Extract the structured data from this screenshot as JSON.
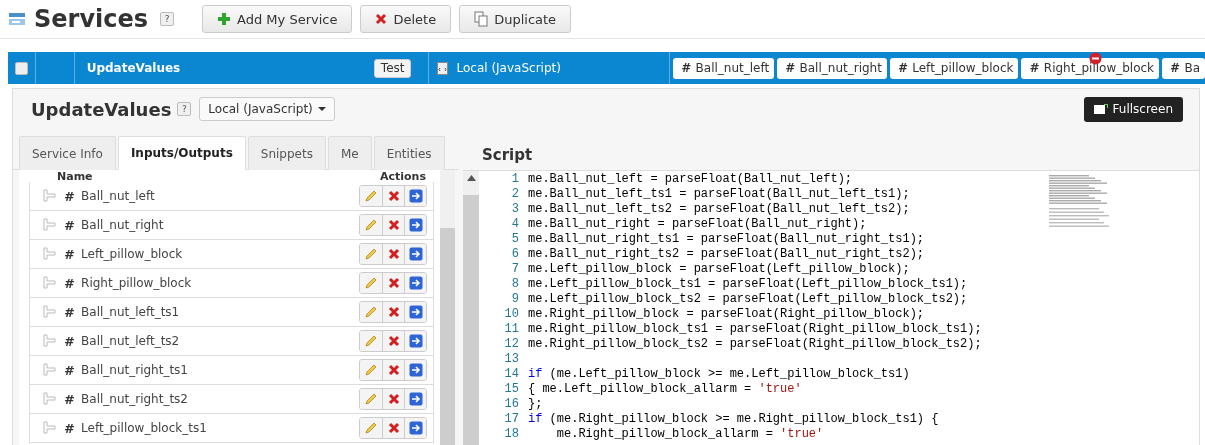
{
  "page": {
    "title": "Services",
    "help": "?"
  },
  "toolbar": [
    {
      "label": "Add My Service",
      "kind": "add"
    },
    {
      "label": "Delete",
      "kind": "delete"
    },
    {
      "label": "Duplicate",
      "kind": "duplicate"
    }
  ],
  "service_row": {
    "checked": false,
    "name": "UpdateValues",
    "test_button": "Test",
    "handler": "Local (JavaScript)",
    "parameters": [
      {
        "symbol": "#",
        "name": "Ball_nut_left",
        "show_remove": false
      },
      {
        "symbol": "#",
        "name": "Ball_nut_right",
        "show_remove": false
      },
      {
        "symbol": "#",
        "name": "Left_pillow_block",
        "show_remove": false
      },
      {
        "symbol": "#",
        "name": "Right_pillow_block",
        "show_remove": true
      },
      {
        "symbol": "#",
        "name": "Ba",
        "show_remove": false
      }
    ]
  },
  "editor": {
    "title": "UpdateValues",
    "help": "?",
    "handler_dropdown": "Local (JavaScript)",
    "fullscreen_button": "Fullscreen",
    "tabs": [
      {
        "label": "Service Info",
        "selected": false
      },
      {
        "label": "Inputs/Outputs",
        "selected": true
      },
      {
        "label": "Snippets",
        "selected": false
      },
      {
        "label": "Me",
        "selected": false
      },
      {
        "label": "Entities",
        "selected": false
      }
    ],
    "script_title": "Script",
    "columns": {
      "name": "Name",
      "actions": "Actions"
    },
    "inputs": [
      {
        "symbol": "#",
        "name": "Ball_nut_left"
      },
      {
        "symbol": "#",
        "name": "Ball_nut_right"
      },
      {
        "symbol": "#",
        "name": "Left_pillow_block"
      },
      {
        "symbol": "#",
        "name": "Right_pillow_block"
      },
      {
        "symbol": "#",
        "name": "Ball_nut_left_ts1"
      },
      {
        "symbol": "#",
        "name": "Ball_nut_left_ts2"
      },
      {
        "symbol": "#",
        "name": "Ball_nut_right_ts1"
      },
      {
        "symbol": "#",
        "name": "Ball_nut_right_ts2"
      },
      {
        "symbol": "#",
        "name": "Left_pillow_block_ts1"
      }
    ],
    "code": [
      {
        "number": "1",
        "tokens": [
          {
            "kind": "plain",
            "text": "me.Ball_nut_left = parseFloat(Ball_nut_left);"
          }
        ]
      },
      {
        "number": "2",
        "tokens": [
          {
            "kind": "plain",
            "text": "me.Ball_nut_left_ts1 = parseFloat(Ball_nut_left_ts1);"
          }
        ]
      },
      {
        "number": "3",
        "tokens": [
          {
            "kind": "plain",
            "text": "me.Ball_nut_left_ts2 = parseFloat(Ball_nut_left_ts2);"
          }
        ]
      },
      {
        "number": "4",
        "tokens": [
          {
            "kind": "plain",
            "text": "me.Ball_nut_right = parseFloat(Ball_nut_right);"
          }
        ]
      },
      {
        "number": "5",
        "tokens": [
          {
            "kind": "plain",
            "text": "me.Ball_nut_right_ts1 = parseFloat(Ball_nut_right_ts1);"
          }
        ]
      },
      {
        "number": "6",
        "tokens": [
          {
            "kind": "plain",
            "text": "me.Ball_nut_right_ts2 = parseFloat(Ball_nut_right_ts2);"
          }
        ]
      },
      {
        "number": "7",
        "tokens": [
          {
            "kind": "plain",
            "text": "me.Left_pillow_block = parseFloat(Left_pillow_block);"
          }
        ]
      },
      {
        "number": "8",
        "tokens": [
          {
            "kind": "plain",
            "text": "me.Left_pillow_block_ts1 = parseFloat(Left_pillow_block_ts1);"
          }
        ]
      },
      {
        "number": "9",
        "tokens": [
          {
            "kind": "plain",
            "text": "me.Left_pillow_block_ts2 = parseFloat(Left_pillow_block_ts2);"
          }
        ]
      },
      {
        "number": "10",
        "tokens": [
          {
            "kind": "plain",
            "text": "me.Right_pillow_block = parseFloat(Right_pillow_block);"
          }
        ]
      },
      {
        "number": "11",
        "tokens": [
          {
            "kind": "plain",
            "text": "me.Right_pillow_block_ts1 = parseFloat(Right_pillow_block_ts1);"
          }
        ]
      },
      {
        "number": "12",
        "tokens": [
          {
            "kind": "plain",
            "text": "me.Right_pillow_block_ts2 = parseFloat(Right_pillow_block_ts2);"
          }
        ]
      },
      {
        "number": "13"
      },
      {
        "number": "14",
        "tokens": [
          {
            "kind": "keyword",
            "text": "if"
          },
          {
            "kind": "plain",
            "text": " (me.Left_pillow_block >= me.Left_pillow_block_ts1)"
          }
        ]
      },
      {
        "number": "15",
        "tokens": [
          {
            "kind": "plain",
            "text": "{ me.Left_pillow_block_allarm = "
          },
          {
            "kind": "string",
            "text": "'true'"
          }
        ]
      },
      {
        "number": "16",
        "tokens": [
          {
            "kind": "plain",
            "text": "};"
          }
        ]
      },
      {
        "number": "17",
        "tokens": [
          {
            "kind": "keyword",
            "text": "if"
          },
          {
            "kind": "plain",
            "text": " (me.Right_pillow_block >= me.Right_pillow_block_ts1) {"
          }
        ]
      },
      {
        "number": "18",
        "tokens": [
          {
            "kind": "plain",
            "text": "    me.Right_pillow_block_allarm = "
          },
          {
            "kind": "string",
            "text": "'true'"
          }
        ]
      }
    ]
  }
}
